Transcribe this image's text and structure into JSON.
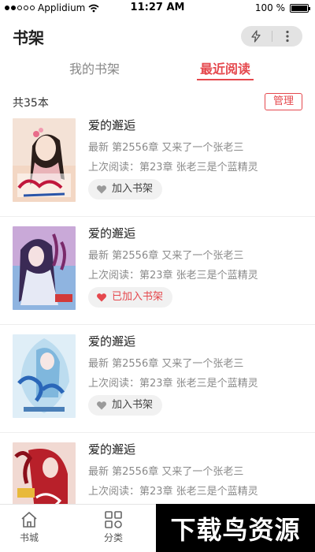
{
  "status_bar": {
    "carrier": "Applidium",
    "time": "11:27 AM",
    "battery": "100 %"
  },
  "header": {
    "title": "书架"
  },
  "tabs": [
    {
      "label": "我的书架",
      "active": false
    },
    {
      "label": "最近阅读",
      "active": true
    }
  ],
  "summary": {
    "count": "共35本",
    "manage_label": "管理"
  },
  "books": [
    {
      "title": "爱的邂逅",
      "latest": "最新 第2556章 又来了一个张老三",
      "last_read": "上次阅读：第23章 张老三是个蓝精灵",
      "shelf_label": "加入书架",
      "added": false
    },
    {
      "title": "爱的邂逅",
      "latest": "最新 第2556章 又来了一个张老三",
      "last_read": "上次阅读：第23章 张老三是个蓝精灵",
      "shelf_label": "已加入书架",
      "added": true
    },
    {
      "title": "爱的邂逅",
      "latest": "最新 第2556章 又来了一个张老三",
      "last_read": "上次阅读：第23章 张老三是个蓝精灵",
      "shelf_label": "加入书架",
      "added": false
    },
    {
      "title": "爱的邂逅",
      "latest": "最新 第2556章 又来了一个张老三",
      "last_read": "上次阅读：第23章 张老三是个蓝精灵",
      "shelf_label": "",
      "added": false
    }
  ],
  "bottom_nav": [
    {
      "label": "书城",
      "icon": "home-icon"
    },
    {
      "label": "分类",
      "icon": "category-icon"
    }
  ],
  "watermark": "下载鸟资源",
  "colors": {
    "accent": "#e5484d",
    "muted_text": "#8a8a8a"
  }
}
